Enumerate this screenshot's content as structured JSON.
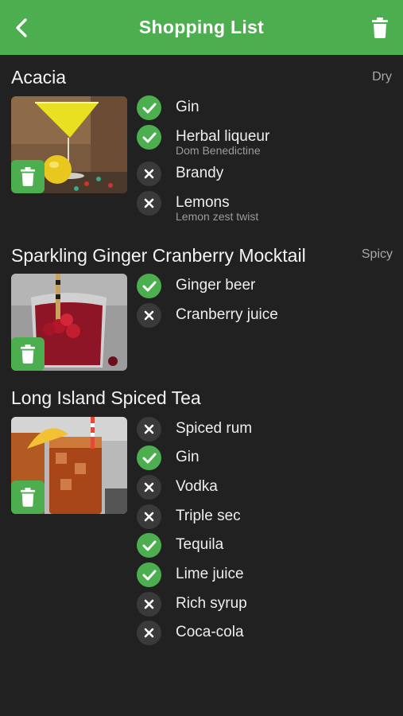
{
  "header": {
    "title": "Shopping List",
    "back_icon": "chevron-left-icon",
    "delete_icon": "trash-icon",
    "background": "#4cae4f"
  },
  "cocktails": [
    {
      "name": "Acacia",
      "tag": "Dry",
      "ingredients": [
        {
          "name": "Gin",
          "have": true
        },
        {
          "name": "Herbal liqueur",
          "note": "Dom Benedictine",
          "have": true
        },
        {
          "name": "Brandy",
          "have": false
        },
        {
          "name": "Lemons",
          "note": "Lemon zest twist",
          "have": false
        }
      ]
    },
    {
      "name": "Sparkling Ginger Cranberry Mocktail",
      "tag": "Spicy",
      "ingredients": [
        {
          "name": "Ginger beer",
          "have": true
        },
        {
          "name": "Cranberry juice",
          "have": false
        }
      ]
    },
    {
      "name": "Long Island Spiced Tea",
      "tag": "",
      "ingredients": [
        {
          "name": "Spiced rum",
          "have": false
        },
        {
          "name": "Gin",
          "have": true
        },
        {
          "name": "Vodka",
          "have": false
        },
        {
          "name": "Triple sec",
          "have": false
        },
        {
          "name": "Tequila",
          "have": true
        },
        {
          "name": "Lime juice",
          "have": true
        },
        {
          "name": "Rich syrup",
          "have": false
        },
        {
          "name": "Coca-cola",
          "have": false
        }
      ]
    }
  ],
  "colors": {
    "accent": "#4cae4f",
    "background": "#212121",
    "missing_badge": "#3a3a3a"
  }
}
